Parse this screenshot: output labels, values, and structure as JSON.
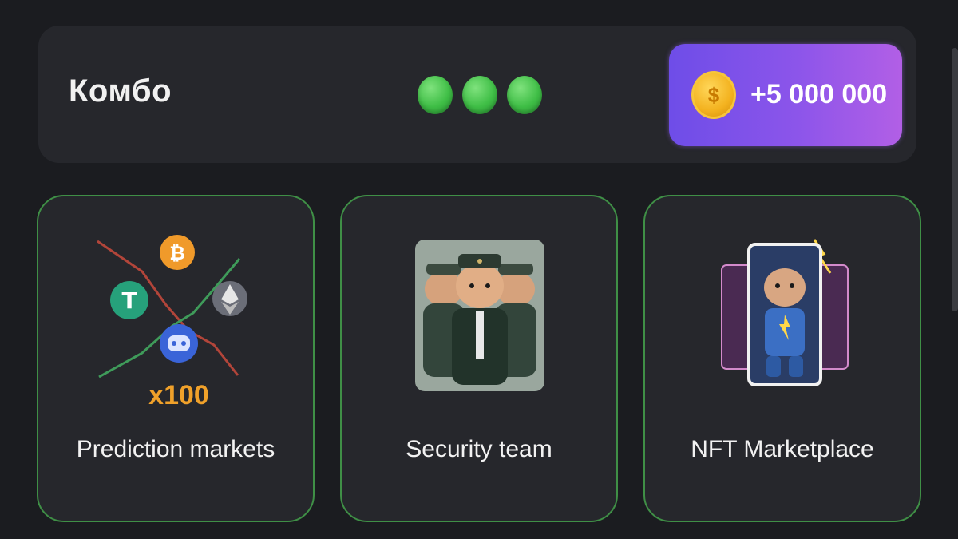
{
  "combo": {
    "title": "Комбо",
    "found_count": 3,
    "dot_color": "#4cc552",
    "reward": {
      "icon": "dollar-coin-icon",
      "coin_symbol": "$",
      "text": "+5 000 000",
      "gradient": [
        "#6e4de8",
        "#b25fe6"
      ]
    }
  },
  "cards": [
    {
      "label": "Prediction markets",
      "multiplier": "x100",
      "icons": [
        "bitcoin-icon",
        "tether-icon",
        "ethereum-icon",
        "discord-icon"
      ]
    },
    {
      "label": "Security team",
      "icon": "hamster-security-team-image"
    },
    {
      "label": "NFT Marketplace",
      "icon": "hamster-nft-cards-image"
    }
  ],
  "colors": {
    "background": "#1b1c20",
    "panel": "#26272c",
    "card_border": "#3f8f46",
    "multiplier": "#f0a12a"
  }
}
